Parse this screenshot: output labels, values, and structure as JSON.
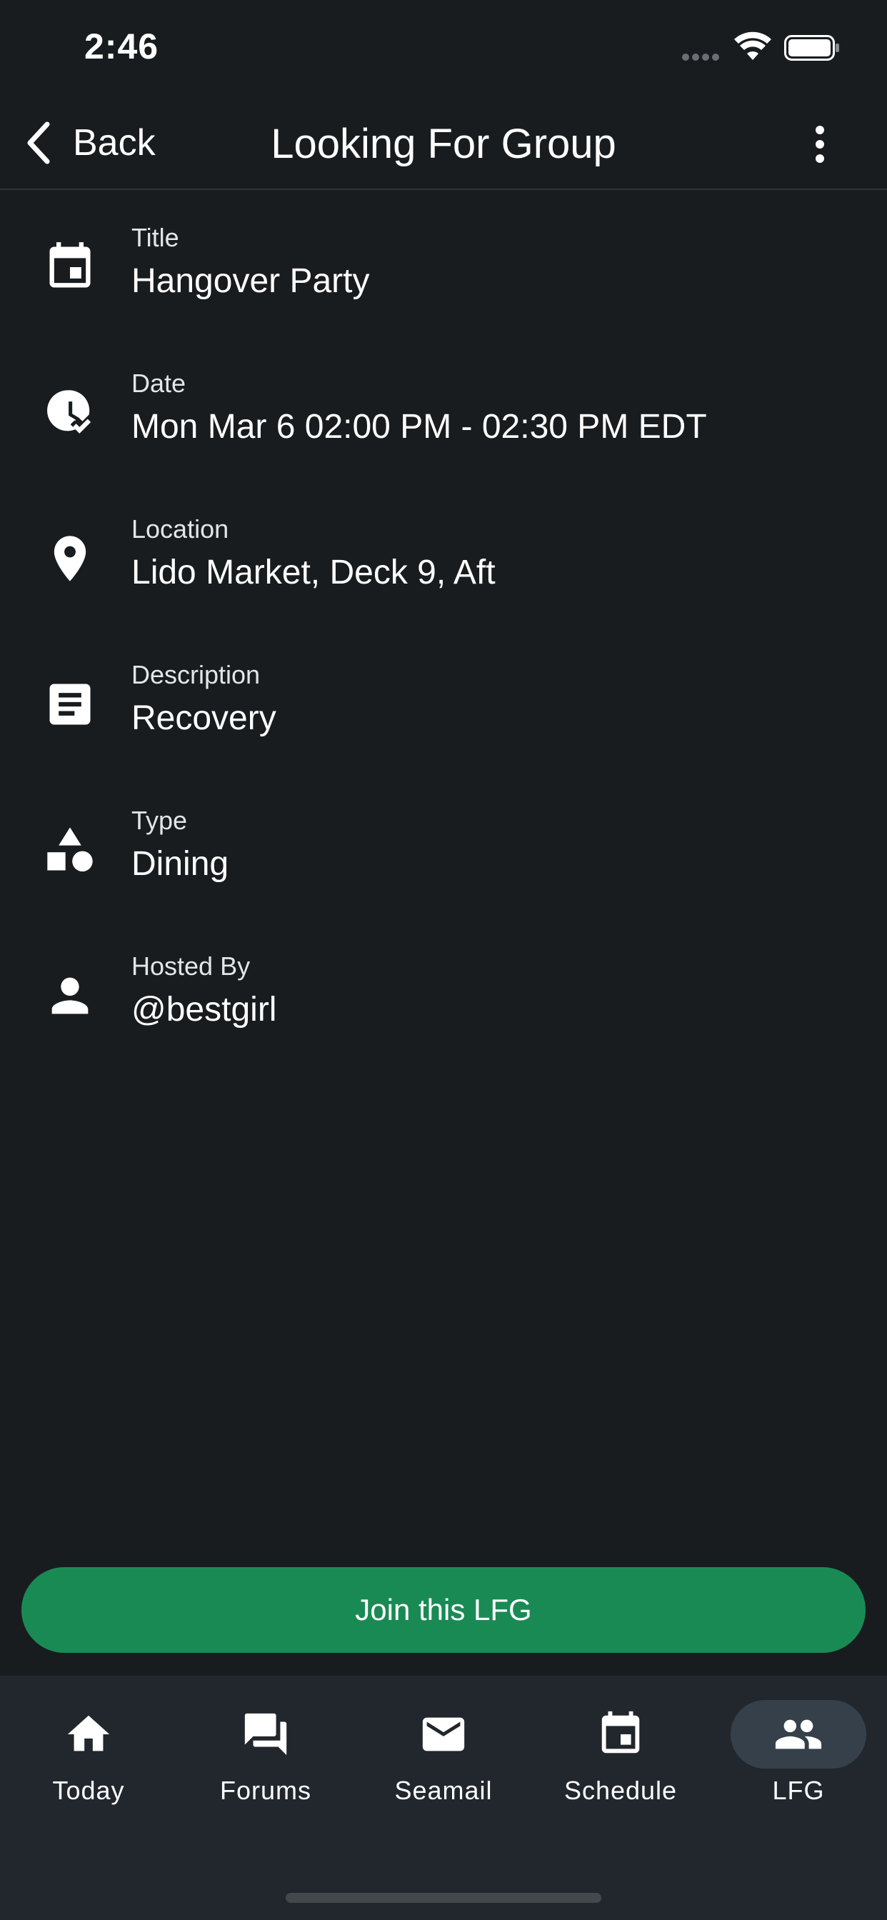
{
  "status_bar": {
    "time": "2:46"
  },
  "nav": {
    "back_label": "Back",
    "title": "Looking For Group"
  },
  "details": [
    {
      "label": "Title",
      "value": "Hangover Party",
      "icon": "calendar-event-icon"
    },
    {
      "label": "Date",
      "value": "Mon Mar 6 02:00 PM - 02:30 PM EDT",
      "icon": "clock-check-icon"
    },
    {
      "label": "Location",
      "value": "Lido Market, Deck 9, Aft",
      "icon": "map-pin-icon"
    },
    {
      "label": "Description",
      "value": "Recovery",
      "icon": "description-icon"
    },
    {
      "label": "Type",
      "value": "Dining",
      "icon": "shapes-icon"
    },
    {
      "label": "Hosted By",
      "value": "@bestgirl",
      "icon": "person-icon"
    }
  ],
  "join_button": {
    "label": "Join this LFG",
    "color": "#1a8a55"
  },
  "tabs": [
    {
      "label": "Today",
      "icon": "home-icon",
      "active": false
    },
    {
      "label": "Forums",
      "icon": "forum-icon",
      "active": false
    },
    {
      "label": "Seamail",
      "icon": "mail-icon",
      "active": false
    },
    {
      "label": "Schedule",
      "icon": "calendar-icon",
      "active": false
    },
    {
      "label": "LFG",
      "icon": "group-icon",
      "active": true
    }
  ]
}
